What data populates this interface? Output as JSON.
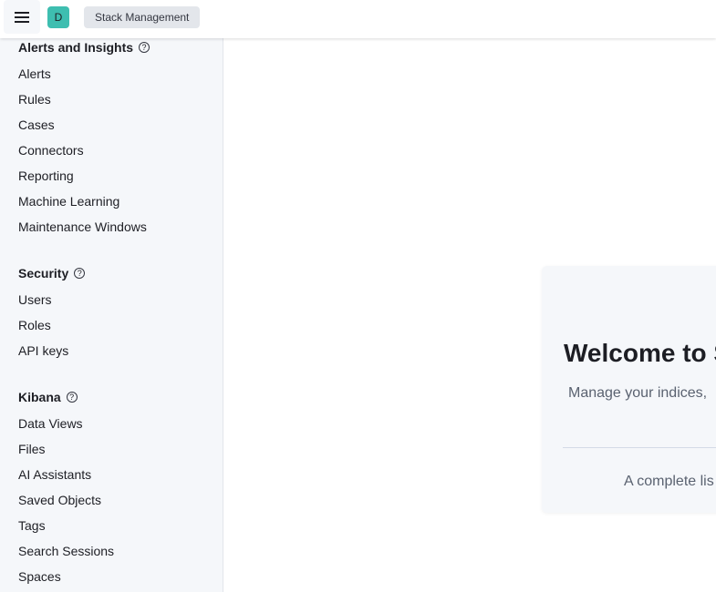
{
  "header": {
    "avatar_initial": "D",
    "breadcrumb": "Stack Management"
  },
  "sidebar": {
    "groups": [
      {
        "title": "Alerts and Insights",
        "items": [
          "Alerts",
          "Rules",
          "Cases",
          "Connectors",
          "Reporting",
          "Machine Learning",
          "Maintenance Windows"
        ]
      },
      {
        "title": "Security",
        "items": [
          "Users",
          "Roles",
          "API keys"
        ]
      },
      {
        "title": "Kibana",
        "items": [
          "Data Views",
          "Files",
          "AI Assistants",
          "Saved Objects",
          "Tags",
          "Search Sessions",
          "Spaces"
        ]
      }
    ],
    "help_glyph": "?"
  },
  "main": {
    "title": "Welcome to S",
    "subtitle": "Manage your indices,",
    "footer": "A complete lis"
  }
}
